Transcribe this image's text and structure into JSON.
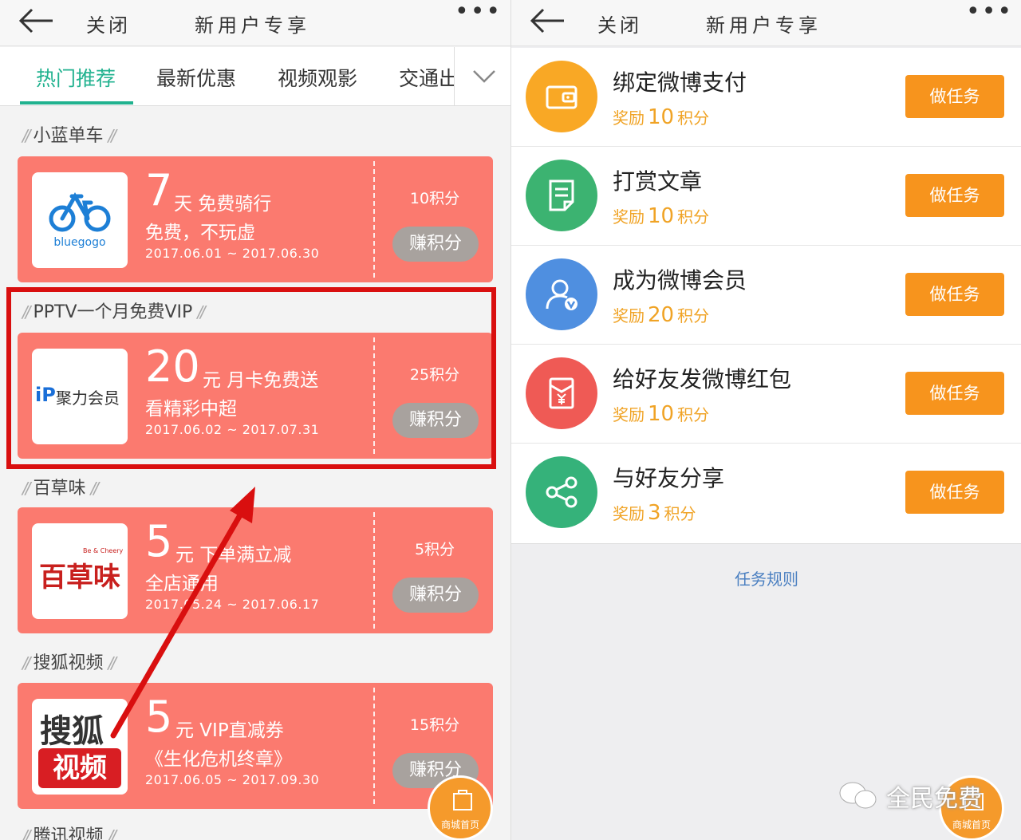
{
  "left": {
    "header": {
      "close": "关闭",
      "title": "新用户专享",
      "more": "•••"
    },
    "tabs": [
      {
        "label": "热门推荐"
      },
      {
        "label": "最新优惠"
      },
      {
        "label": "视频观影"
      },
      {
        "label": "交通出"
      }
    ],
    "sections": [
      {
        "title": "小蓝单车",
        "amount": "7",
        "unit": "天 免费骑行",
        "desc": "免费，不玩虚",
        "dates": "2017.06.01 ~ 2017.06.30",
        "points": "10积分",
        "button": "赚积分",
        "logo_text": "bluegogo"
      },
      {
        "title": "PPTV一个月免费VIP",
        "amount": "20",
        "unit": "元 月卡免费送",
        "desc": "看精彩中超",
        "dates": "2017.06.02 ~ 2017.07.31",
        "points": "25积分",
        "button": "赚积分",
        "logo_text": "聚力会员"
      },
      {
        "title": "百草味",
        "amount": "5",
        "unit": "元 下单满立减",
        "desc": "全店通用",
        "dates": "2017.05.24 ~ 2017.06.17",
        "points": "5积分",
        "button": "赚积分",
        "logo_text": "百草味",
        "logo_subtext": "Be & Cheery"
      },
      {
        "title": "搜狐视频",
        "amount": "5",
        "unit": "元 VIP直减券",
        "desc": "《生化危机终章》",
        "dates": "2017.06.05 ~ 2017.09.30",
        "points": "15积分",
        "button": "赚积分",
        "logo_text": "搜狐",
        "logo_text2": "视频"
      },
      {
        "title": "腾讯视频"
      }
    ],
    "fab_label": "商城首页"
  },
  "right": {
    "header": {
      "close": "关闭",
      "title": "新用户专享",
      "more": "•••"
    },
    "tasks": [
      {
        "name": "绑定微博支付",
        "reward_prefix": "奖励",
        "reward_value": "10",
        "reward_suffix": "积分",
        "button": "做任务",
        "icon": "wallet-icon",
        "color": "#f9a825"
      },
      {
        "name": "打赏文章",
        "reward_prefix": "奖励",
        "reward_value": "10",
        "reward_suffix": "积分",
        "button": "做任务",
        "icon": "document-icon",
        "color": "#3cb371"
      },
      {
        "name": "成为微博会员",
        "reward_prefix": "奖励",
        "reward_value": "20",
        "reward_suffix": "积分",
        "button": "做任务",
        "icon": "vip-user-icon",
        "color": "#4f8fe0"
      },
      {
        "name": "给好友发微博红包",
        "reward_prefix": "奖励",
        "reward_value": "10",
        "reward_suffix": "积分",
        "button": "做任务",
        "icon": "red-packet-icon",
        "color": "#ef5a55"
      },
      {
        "name": "与好友分享",
        "reward_prefix": "奖励",
        "reward_value": "3",
        "reward_suffix": "积分",
        "button": "做任务",
        "icon": "share-icon",
        "color": "#35b27a"
      }
    ],
    "rules_link": "任务规则",
    "fab_label": "商城首页",
    "watermark": "全民免费"
  },
  "colors": {
    "accent_green": "#21b28f",
    "coupon_red": "#fb7a6f",
    "task_orange": "#f7941d",
    "highlight_red": "#d90f0f"
  }
}
